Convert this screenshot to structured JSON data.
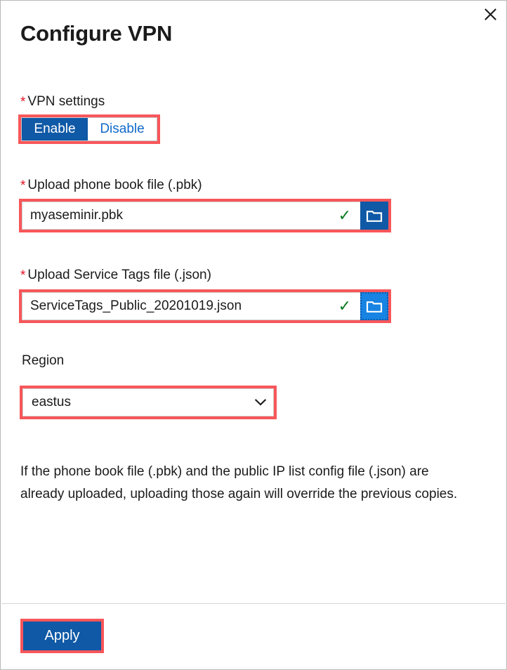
{
  "dialog": {
    "title": "Configure VPN",
    "close_label": "×",
    "close_icon": "close-icon"
  },
  "vpn_settings": {
    "label": "VPN settings",
    "required_marker": "*",
    "required": true,
    "options": [
      "Enable",
      "Disable"
    ],
    "selected": "Enable",
    "enable_label": "Enable",
    "disable_label": "Disable"
  },
  "phone_book_upload": {
    "label": "Upload phone book file (.pbk)",
    "required_marker": "*",
    "required": true,
    "value": "myaseminir.pbk",
    "placeholder": "",
    "validation_icon": "✓",
    "valid": true,
    "browse_icon": "folder-icon",
    "browse_label": "Browse"
  },
  "service_tags_upload": {
    "label": "Upload Service Tags file (.json)",
    "required_marker": "*",
    "required": true,
    "value": "ServiceTags_Public_20201019.json",
    "placeholder": "",
    "validation_icon": "✓",
    "valid": true,
    "browse_icon": "folder-icon",
    "browse_label": "Browse"
  },
  "region": {
    "label": "Region",
    "required": false,
    "selected": "eastus",
    "chevron_icon": "chevron-down-icon"
  },
  "help": {
    "text": "If the phone book file (.pbk) and the public IP list config file (.json) are already uploaded, uploading those again will override the previous copies."
  },
  "footer": {
    "apply_label": "Apply"
  },
  "colors": {
    "accent_blue": "#0f59a6",
    "link_blue": "#1169c9",
    "browse_blue_focus": "#1783e3",
    "annotation_red": "#f8565a",
    "required_red": "#e81123",
    "valid_green": "#0a7a22",
    "text": "#1b1b1b",
    "border_gray": "#cfcfcf"
  }
}
